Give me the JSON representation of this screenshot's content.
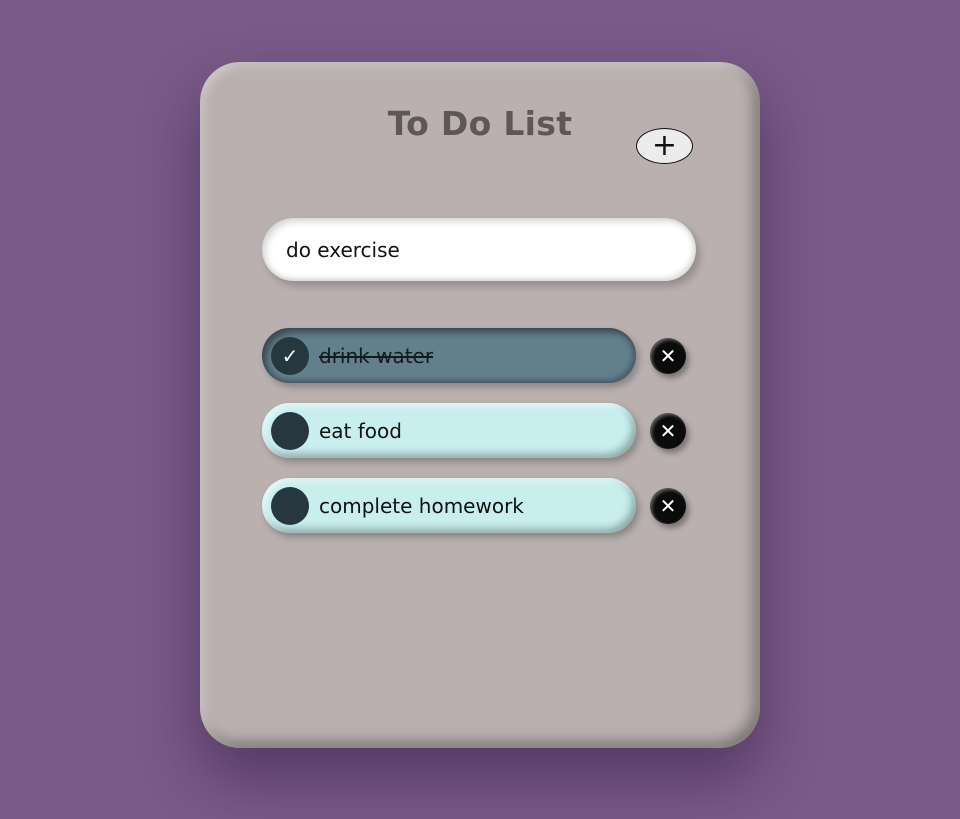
{
  "app": {
    "title": "To Do List",
    "add_button_label": "+",
    "colors": {
      "background": "#7a5a87",
      "card": "#b9b0af",
      "pending_item": "#c8efee",
      "done_item": "#627f8c",
      "check_circle": "#263740",
      "delete_button": "#0b0b0b"
    }
  },
  "input": {
    "value": "do exercise",
    "placeholder": ""
  },
  "todos": [
    {
      "text": "drink water",
      "completed": true,
      "check_icon": "✓",
      "delete_icon": "✕"
    },
    {
      "text": "eat food",
      "completed": false,
      "check_icon": "",
      "delete_icon": "✕"
    },
    {
      "text": "complete homework",
      "completed": false,
      "check_icon": "",
      "delete_icon": "✕"
    }
  ]
}
